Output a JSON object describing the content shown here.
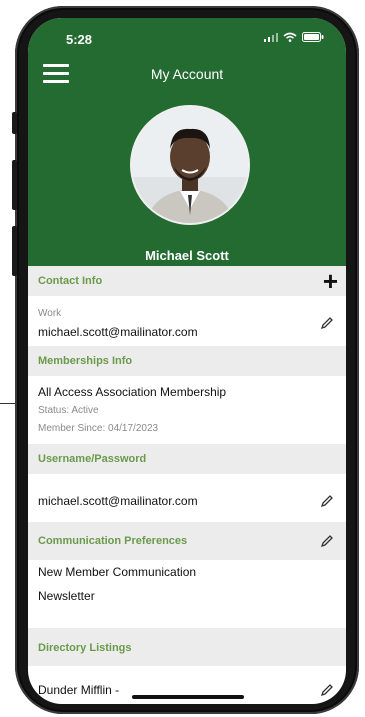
{
  "status_bar": {
    "time": "5:28"
  },
  "header": {
    "title": "My Account",
    "user_name": "Michael Scott"
  },
  "contact": {
    "section_title": "Contact Info",
    "type_label": "Work",
    "email": "michael.scott@mailinator.com"
  },
  "membership": {
    "section_title": "Memberships Info",
    "name": "All Access Association Membership",
    "status": "Status: Active",
    "since": "Member Since: 04/17/2023"
  },
  "credentials": {
    "section_title": "Username/Password",
    "username": "michael.scott@mailinator.com"
  },
  "communication": {
    "section_title": "Communication Preferences",
    "items": [
      "New Member Communication",
      "Newsletter"
    ]
  },
  "directory": {
    "section_title": "Directory Listings",
    "first_item": "Dunder Mifflin -"
  },
  "colors": {
    "header_green": "#246b32",
    "section_title_green": "#6b9a4b",
    "section_bg": "#ececec"
  }
}
